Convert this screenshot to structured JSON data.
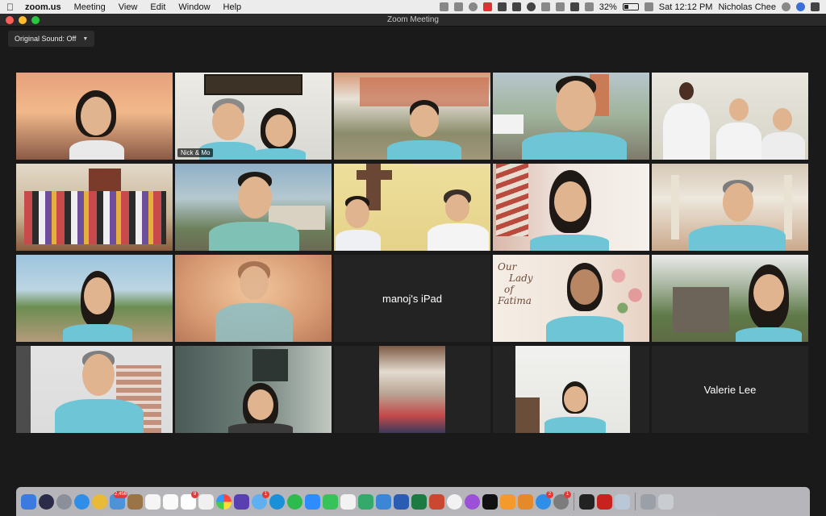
{
  "menubar": {
    "app_name": "zoom.us",
    "menus": [
      "Meeting",
      "View",
      "Edit",
      "Window",
      "Help"
    ],
    "battery": "32%",
    "battery_level": 0.32,
    "clock": "Sat 12:12 PM",
    "user": "Nicholas Chee"
  },
  "window": {
    "title": "Zoom Meeting"
  },
  "controls": {
    "original_sound": "Original Sound: Off"
  },
  "participants": [
    {
      "label": "",
      "video": true
    },
    {
      "label": "Nick & Mo",
      "video": true,
      "active_speaker": true
    },
    {
      "label": "",
      "video": true
    },
    {
      "label": "",
      "video": true
    },
    {
      "label": "",
      "video": true
    },
    {
      "label": "",
      "video": true
    },
    {
      "label": "",
      "video": true
    },
    {
      "label": "",
      "video": true
    },
    {
      "label": "",
      "video": true
    },
    {
      "label": "",
      "video": true
    },
    {
      "label": "",
      "video": true
    },
    {
      "label": "",
      "video": true
    },
    {
      "label": "manoj's iPad",
      "video": false
    },
    {
      "label": "Our Lady of Fatima",
      "video": true
    },
    {
      "label": "",
      "video": true
    },
    {
      "label": "",
      "video": true
    },
    {
      "label": "",
      "video": true
    },
    {
      "label": "",
      "video": true
    },
    {
      "label": "",
      "video": true
    },
    {
      "label": "Valerie Lee",
      "video": false
    }
  ],
  "tile_texts": {
    "nick_mo": "Nick & Mo",
    "manoj": "manoj's iPad",
    "fatima_line1": "Our",
    "fatima_line2": "Lady",
    "fatima_line3": "of",
    "fatima_line4": "Fatima",
    "valerie": "Valerie Lee"
  },
  "dock": {
    "badges": {
      "calendar": "9",
      "mail": "2,456",
      "messages": "1",
      "appstore": "2",
      "prefs": "1"
    }
  },
  "colors": {
    "accent_speaker": "#e7e26a",
    "shirt_teal": "#6ec5d6",
    "meeting_bg": "#1a1a1a"
  }
}
